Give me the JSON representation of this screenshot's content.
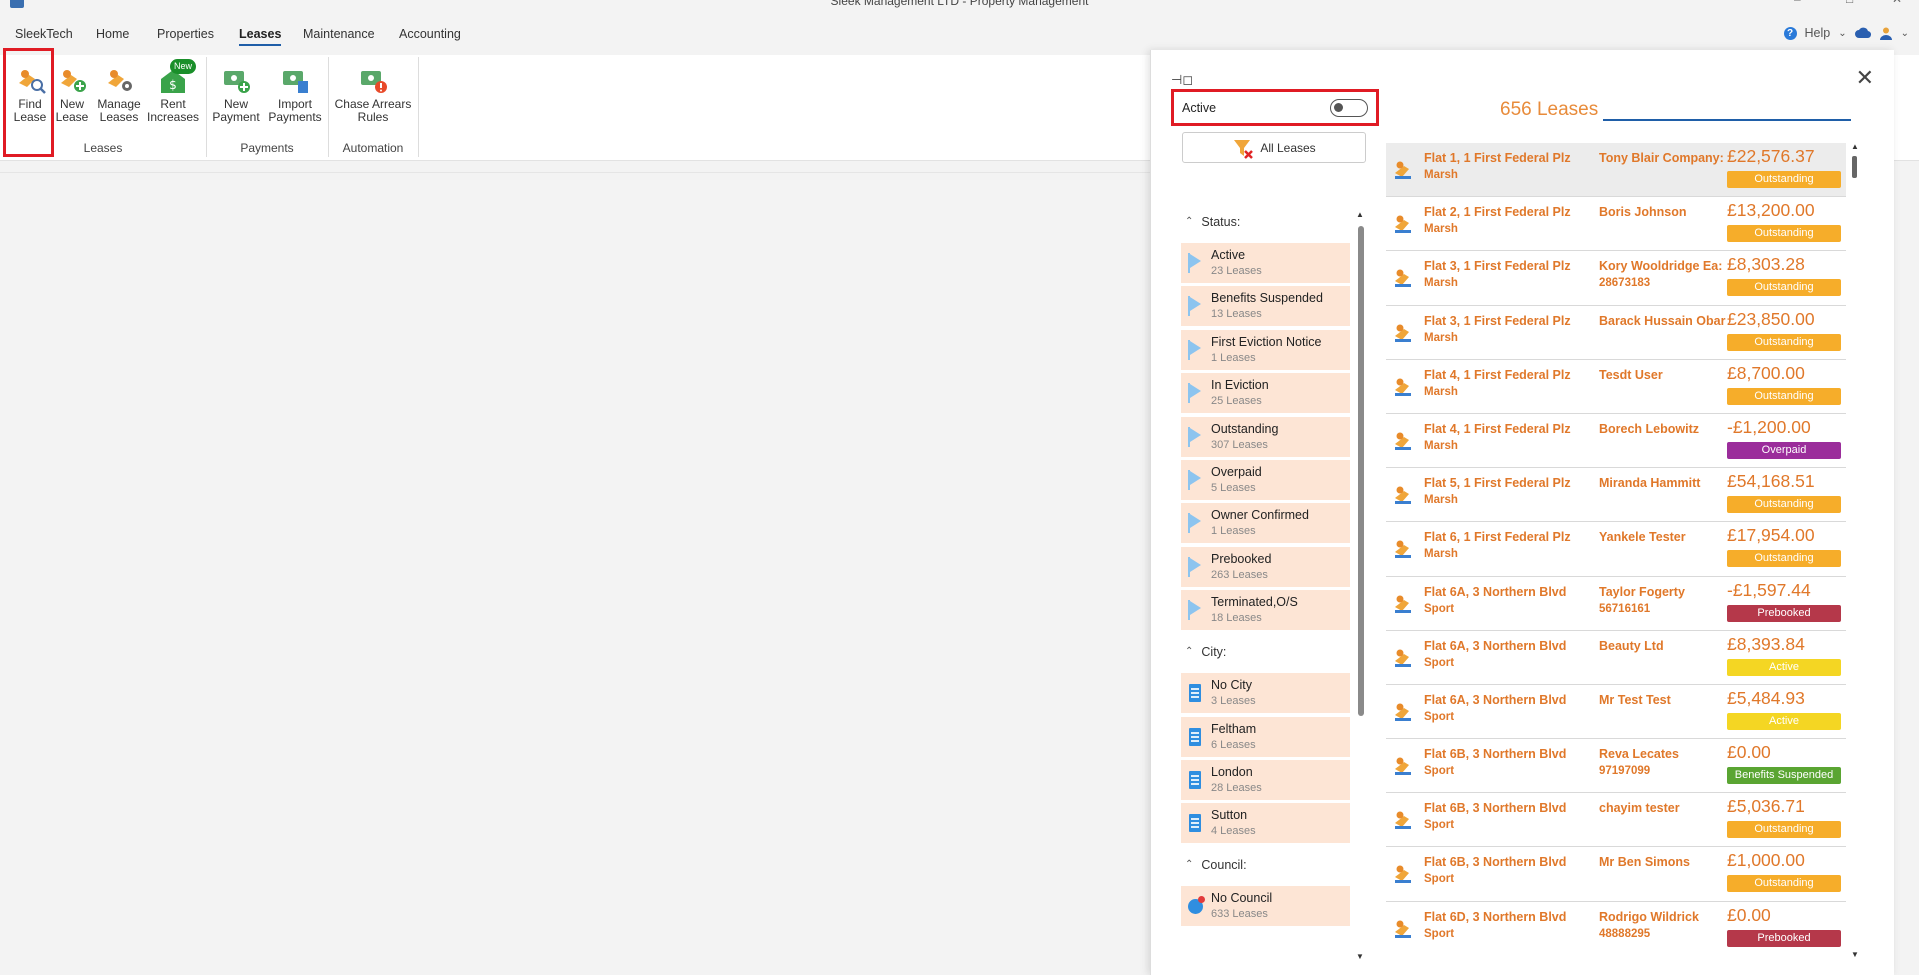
{
  "window": {
    "title": "Sleek Management LTD - Property Management",
    "controls": [
      "–",
      "□",
      "✕"
    ]
  },
  "menu": [
    {
      "label": "SleekTech"
    },
    {
      "label": "Home"
    },
    {
      "label": "Properties"
    },
    {
      "label": "Leases",
      "active": true
    },
    {
      "label": "Maintenance"
    },
    {
      "label": "Accounting"
    }
  ],
  "help": {
    "label": "Help"
  },
  "ribbon": {
    "leases_group": "Leases",
    "payments_group": "Payments",
    "automation_group": "Automation",
    "buttons": [
      {
        "line1": "Find",
        "line2": "Lease"
      },
      {
        "line1": "New",
        "line2": "Lease"
      },
      {
        "line1": "Manage",
        "line2": "Leases"
      },
      {
        "line1": "Rent",
        "line2": "Increases",
        "badge": "New"
      },
      {
        "line1": "New",
        "line2": "Payment"
      },
      {
        "line1": "Import",
        "line2": "Payments"
      },
      {
        "line1": "Chase Arrears",
        "line2": "Rules"
      }
    ]
  },
  "panel": {
    "active_label": "Active",
    "active_on": false,
    "all_leases": "All  Leases",
    "count_label": "656 Leases",
    "search_value": "",
    "status_title": "Status:",
    "status": [
      {
        "name": "Active",
        "count": "23  Leases"
      },
      {
        "name": "Benefits Suspended",
        "count": "13  Leases"
      },
      {
        "name": "First Eviction Notice",
        "count": "1  Leases"
      },
      {
        "name": "In Eviction",
        "count": "25  Leases"
      },
      {
        "name": "Outstanding",
        "count": "307  Leases"
      },
      {
        "name": "Overpaid",
        "count": "5  Leases"
      },
      {
        "name": "Owner Confirmed",
        "count": "1  Leases"
      },
      {
        "name": "Prebooked",
        "count": "263  Leases"
      },
      {
        "name": "Terminated,O/S",
        "count": "18  Leases"
      }
    ],
    "city_title": "City:",
    "city": [
      {
        "name": "No City",
        "count": "3  Leases"
      },
      {
        "name": "Feltham",
        "count": "6  Leases"
      },
      {
        "name": "London",
        "count": "28  Leases"
      },
      {
        "name": "Sutton",
        "count": "4  Leases"
      }
    ],
    "council_title": "Council:",
    "council": [
      {
        "name": "No Council",
        "count": "633  Leases"
      }
    ]
  },
  "badge_colors": {
    "Outstanding": "#f6ad2a",
    "Overpaid": "#9b2d9b",
    "Prebooked": "#b5384a",
    "Active": "#f4d623",
    "Benefits Suspended": "#5aa532"
  },
  "leases": [
    {
      "address": "Flat 1, 1 First Federal Plz",
      "area": "Marsh",
      "tenant": "Tony Blair Company:",
      "tel": "",
      "amount": "£22,576.37",
      "status": "Outstanding",
      "selected": true
    },
    {
      "address": "Flat 2, 1 First Federal Plz",
      "area": "Marsh",
      "tenant": "Boris Johnson",
      "tel": "",
      "amount": "£13,200.00",
      "status": "Outstanding"
    },
    {
      "address": "Flat 3, 1 First Federal Plz",
      "area": "Marsh",
      "tenant": "Kory Wooldridge Ea:",
      "tel": "28673183",
      "amount": "£8,303.28",
      "status": "Outstanding"
    },
    {
      "address": "Flat 3, 1 First Federal Plz",
      "area": "Marsh",
      "tenant": "Barack Hussain Obar",
      "tel": "",
      "amount": "£23,850.00",
      "status": "Outstanding"
    },
    {
      "address": "Flat 4, 1 First Federal Plz",
      "area": "Marsh",
      "tenant": "Tesdt User",
      "tel": "",
      "amount": "£8,700.00",
      "status": "Outstanding"
    },
    {
      "address": "Flat 4, 1 First Federal Plz",
      "area": "Marsh",
      "tenant": "Borech Lebowitz",
      "tel": "",
      "amount": "-£1,200.00",
      "status": "Overpaid"
    },
    {
      "address": "Flat 5, 1 First Federal Plz",
      "area": "Marsh",
      "tenant": "Miranda Hammitt",
      "tel": "",
      "amount": "£54,168.51",
      "status": "Outstanding"
    },
    {
      "address": "Flat 6, 1 First Federal Plz",
      "area": "Marsh",
      "tenant": "Yankele Tester",
      "tel": "",
      "amount": "£17,954.00",
      "status": "Outstanding"
    },
    {
      "address": "Flat 6A, 3 Northern Blvd",
      "area": "Sport",
      "tenant": "Taylor Fogerty",
      "tel": "56716161",
      "amount": "-£1,597.44",
      "status": "Prebooked"
    },
    {
      "address": "Flat 6A, 3 Northern Blvd",
      "area": "Sport",
      "tenant": "Beauty Ltd",
      "tel": "",
      "amount": "£8,393.84",
      "status": "Active"
    },
    {
      "address": "Flat 6A, 3 Northern Blvd",
      "area": "Sport",
      "tenant": "Mr Test Test",
      "tel": "",
      "amount": "£5,484.93",
      "status": "Active"
    },
    {
      "address": "Flat 6B, 3 Northern Blvd",
      "area": "Sport",
      "tenant": "Reva Lecates",
      "tel": "97197099",
      "amount": "£0.00",
      "status": "Benefits Suspended"
    },
    {
      "address": "Flat 6B, 3 Northern Blvd",
      "area": "Sport",
      "tenant": "chayim tester",
      "tel": "",
      "amount": "£5,036.71",
      "status": "Outstanding"
    },
    {
      "address": "Flat 6B, 3 Northern Blvd",
      "area": "Sport",
      "tenant": "Mr Ben Simons",
      "tel": "",
      "amount": "£1,000.00",
      "status": "Outstanding"
    },
    {
      "address": "Flat 6D, 3 Northern Blvd",
      "area": "Sport",
      "tenant": "Rodrigo Wildrick",
      "tel": "48888295",
      "amount": "£0.00",
      "status": "Prebooked"
    }
  ]
}
